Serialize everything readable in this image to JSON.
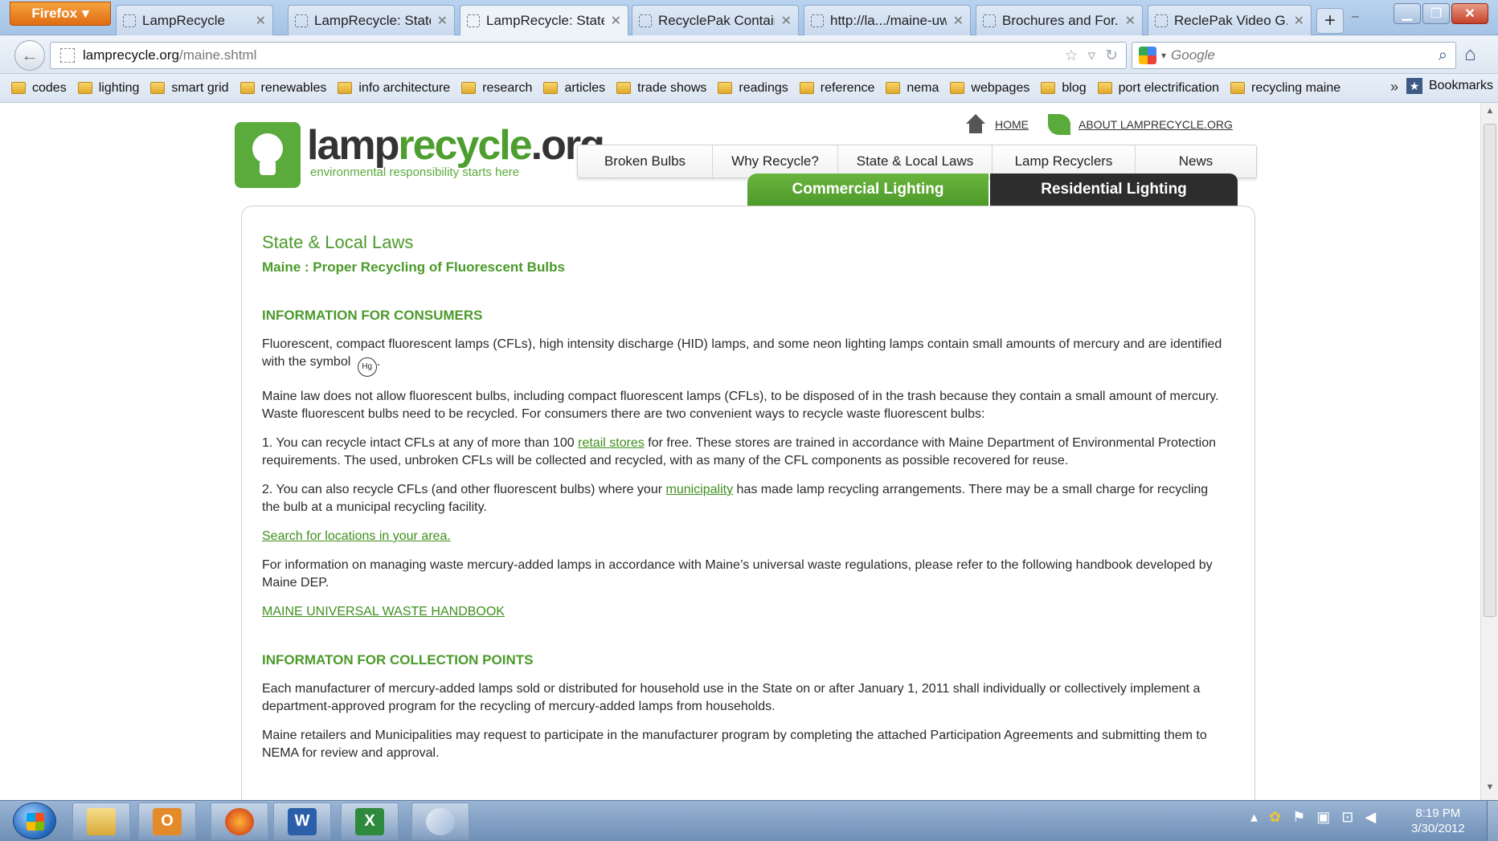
{
  "browser": {
    "firefox_label": "Firefox",
    "tabs": [
      {
        "label": "LampRecycle"
      },
      {
        "label": "LampRecycle: State..."
      },
      {
        "label": "LampRecycle: State..."
      },
      {
        "label": "RecyclePak Contain..."
      },
      {
        "label": "http://la.../maine-uw"
      },
      {
        "label": "Brochures and For..."
      },
      {
        "label": "ReclePak Video G..."
      }
    ],
    "url_host": "lamprecycle.org",
    "url_path": "/maine.shtml",
    "search_placeholder": "Google",
    "bookmarks": [
      "codes",
      "lighting",
      "smart grid",
      "renewables",
      "info architecture",
      "research",
      "articles",
      "trade shows",
      "readings",
      "reference",
      "nema",
      "webpages",
      "blog",
      "port electrification",
      "recycling maine"
    ],
    "bookmarks_menu": "Bookmarks"
  },
  "site": {
    "logo_name_part1": "lamp",
    "logo_name_part2": "recycle",
    "logo_name_part3": ".org",
    "logo_tagline": "environmental responsibility starts here",
    "home_link": "HOME",
    "about_link": "ABOUT LAMPRECYCLE.ORG",
    "nav": [
      "Broken Bulbs",
      "Why Recycle?",
      "State & Local Laws",
      "Lamp Recyclers",
      "News"
    ],
    "tab_commercial": "Commercial Lighting",
    "tab_residential": "Residential Lighting"
  },
  "content": {
    "page_title": "State & Local Laws",
    "subtitle": "Maine : Proper Recycling of Fluorescent Bulbs",
    "section1_heading": "INFORMATION FOR CONSUMERS",
    "p1": "Fluorescent, compact fluorescent lamps (CFLs), high intensity discharge (HID) lamps, and some neon lighting lamps contain small amounts of mercury and are identified with the symbol",
    "hg_symbol": "Hg",
    "p2": "Maine law does not allow fluorescent bulbs, including compact fluorescent lamps (CFLs), to be disposed of in the trash because they contain a small amount of mercury. Waste fluorescent bulbs need to be recycled. For consumers there are two convenient ways to recycle waste fluorescent bulbs:",
    "p3_before": "1. You can recycle intact CFLs at any of more than 100 ",
    "p3_link": "retail stores",
    "p3_after": " for free. These stores are trained in accordance with Maine Department of Environmental Protection requirements. The used, unbroken CFLs will be collected and recycled, with as many of the CFL components as possible recovered for reuse.",
    "p4_before": "2. You can also recycle CFLs (and other fluorescent bulbs) where your ",
    "p4_link": "municipality",
    "p4_after": " has made lamp recycling arrangements. There may be a small charge for recycling the bulb at a municipal recycling facility.",
    "search_link": "Search for locations in your area.",
    "p5": "For information on managing waste mercury-added lamps in accordance with Maine’s universal waste regulations, please refer to the following handbook developed by Maine DEP.",
    "handbook_link": "MAINE UNIVERSAL WASTE HANDBOOK",
    "section2_heading": "INFORMATON FOR COLLECTION POINTS",
    "p6": "Each manufacturer of mercury-added lamps sold or distributed for household use in the State on or after January 1, 2011 shall individually or collectively implement a department-approved program for the recycling of mercury-added lamps from households.",
    "p7": "Maine retailers and Municipalities may request to participate in the manufacturer program by completing the attached Participation Agreements and submitting them to NEMA for review and approval."
  },
  "taskbar": {
    "time": "8:19 PM",
    "date": "3/30/2012"
  },
  "colors": {
    "brand_green": "#4b9a2a",
    "residential_tab": "#2d2d2d"
  }
}
